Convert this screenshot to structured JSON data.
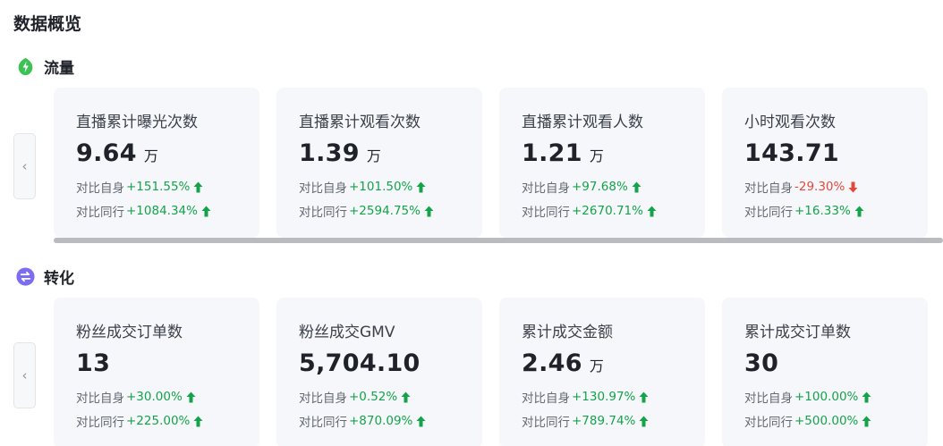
{
  "page": {
    "title": "数据概览"
  },
  "colors": {
    "up": "#15a34a",
    "down": "#e5483b",
    "flow_icon": "#3cc254",
    "conv_icon": "#7b6cf0"
  },
  "icons": {
    "flow": "leaf-lightning-icon",
    "conv": "exchange-icon",
    "prev": "chevron-left-icon",
    "up": "arrow-up-icon",
    "down": "arrow-down-icon"
  },
  "sections": [
    {
      "label": "流量",
      "cards": [
        {
          "label": "直播累计曝光次数",
          "value": "9.64",
          "unit": "万",
          "self_label": "对比自身",
          "self_val": "+151.55%",
          "self_dir": "up",
          "peer_label": "对比同行",
          "peer_val": "+1084.34%",
          "peer_dir": "up"
        },
        {
          "label": "直播累计观看次数",
          "value": "1.39",
          "unit": "万",
          "self_label": "对比自身",
          "self_val": "+101.50%",
          "self_dir": "up",
          "peer_label": "对比同行",
          "peer_val": "+2594.75%",
          "peer_dir": "up"
        },
        {
          "label": "直播累计观看人数",
          "value": "1.21",
          "unit": "万",
          "self_label": "对比自身",
          "self_val": "+97.68%",
          "self_dir": "up",
          "peer_label": "对比同行",
          "peer_val": "+2670.71%",
          "peer_dir": "up"
        },
        {
          "label": "小时观看次数",
          "value": "143.71",
          "unit": "",
          "self_label": "对比自身",
          "self_val": "-29.30%",
          "self_dir": "down",
          "peer_label": "对比同行",
          "peer_val": "+16.33%",
          "peer_dir": "up"
        }
      ]
    },
    {
      "label": "转化",
      "cards": [
        {
          "label": "粉丝成交订单数",
          "value": "13",
          "unit": "",
          "self_label": "对比自身",
          "self_val": "+30.00%",
          "self_dir": "up",
          "peer_label": "对比同行",
          "peer_val": "+225.00%",
          "peer_dir": "up"
        },
        {
          "label": "粉丝成交GMV",
          "value": "5,704.10",
          "unit": "",
          "self_label": "对比自身",
          "self_val": "+0.52%",
          "self_dir": "up",
          "peer_label": "对比同行",
          "peer_val": "+870.09%",
          "peer_dir": "up"
        },
        {
          "label": "累计成交金额",
          "value": "2.46",
          "unit": "万",
          "self_label": "对比自身",
          "self_val": "+130.97%",
          "self_dir": "up",
          "peer_label": "对比同行",
          "peer_val": "+789.74%",
          "peer_dir": "up"
        },
        {
          "label": "累计成交订单数",
          "value": "30",
          "unit": "",
          "self_label": "对比自身",
          "self_val": "+100.00%",
          "self_dir": "up",
          "peer_label": "对比同行",
          "peer_val": "+500.00%",
          "peer_dir": "up"
        }
      ]
    }
  ]
}
